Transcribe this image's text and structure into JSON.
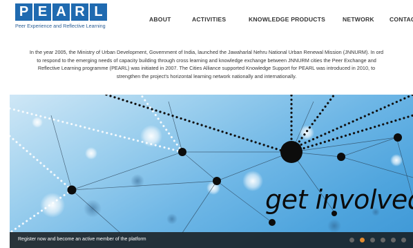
{
  "logo": {
    "letters": [
      "P",
      "E",
      "A",
      "R",
      "L"
    ],
    "tagline": "Peer Experience and Reflective Learning"
  },
  "nav": {
    "items": [
      "ABOUT",
      "ACTIVITIES",
      "KNOWLEDGE PRODUCTS",
      "NETWORK",
      "CONTAC"
    ]
  },
  "intro": {
    "lines": [
      "In the year 2005, the Ministry of Urban Development, Government of India, launched the Jawaharlal Nehru National Urban Renewal Mission (JNNURM). In ord",
      "to respond to the emerging needs of capacity building through cross learning and knowledge exchange between JNNURM cities the Peer Exchange and",
      "Reflective Learning programme (PEARL) was initiated in 2007. The Cities Alliance supported Knowledge Support for PEARL was introduced in 2010, to",
      "strengthen the project's horizontal learning network nationally and internationally."
    ]
  },
  "banner": {
    "headline": "get involved",
    "caption": "Register now and become an active member of the platform",
    "slide_count": 6,
    "active_slide": 2
  },
  "colors": {
    "brand": "#1f6ab0",
    "dot_active": "#e38a2e",
    "dot_inactive": "#666666"
  }
}
